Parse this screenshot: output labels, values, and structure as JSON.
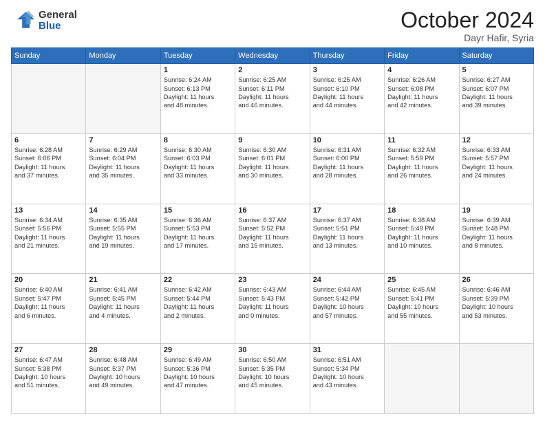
{
  "logo": {
    "general": "General",
    "blue": "Blue"
  },
  "header": {
    "month": "October 2024",
    "location": "Dayr Hafir, Syria"
  },
  "weekdays": [
    "Sunday",
    "Monday",
    "Tuesday",
    "Wednesday",
    "Thursday",
    "Friday",
    "Saturday"
  ],
  "weeks": [
    [
      {
        "day": "",
        "info": ""
      },
      {
        "day": "",
        "info": ""
      },
      {
        "day": "1",
        "info": "Sunrise: 6:24 AM\nSunset: 6:13 PM\nDaylight: 11 hours\nand 48 minutes."
      },
      {
        "day": "2",
        "info": "Sunrise: 6:25 AM\nSunset: 6:11 PM\nDaylight: 11 hours\nand 46 minutes."
      },
      {
        "day": "3",
        "info": "Sunrise: 6:25 AM\nSunset: 6:10 PM\nDaylight: 11 hours\nand 44 minutes."
      },
      {
        "day": "4",
        "info": "Sunrise: 6:26 AM\nSunset: 6:08 PM\nDaylight: 11 hours\nand 42 minutes."
      },
      {
        "day": "5",
        "info": "Sunrise: 6:27 AM\nSunset: 6:07 PM\nDaylight: 11 hours\nand 39 minutes."
      }
    ],
    [
      {
        "day": "6",
        "info": "Sunrise: 6:28 AM\nSunset: 6:06 PM\nDaylight: 11 hours\nand 37 minutes."
      },
      {
        "day": "7",
        "info": "Sunrise: 6:29 AM\nSunset: 6:04 PM\nDaylight: 11 hours\nand 35 minutes."
      },
      {
        "day": "8",
        "info": "Sunrise: 6:30 AM\nSunset: 6:03 PM\nDaylight: 11 hours\nand 33 minutes."
      },
      {
        "day": "9",
        "info": "Sunrise: 6:30 AM\nSunset: 6:01 PM\nDaylight: 11 hours\nand 30 minutes."
      },
      {
        "day": "10",
        "info": "Sunrise: 6:31 AM\nSunset: 6:00 PM\nDaylight: 11 hours\nand 28 minutes."
      },
      {
        "day": "11",
        "info": "Sunrise: 6:32 AM\nSunset: 5:59 PM\nDaylight: 11 hours\nand 26 minutes."
      },
      {
        "day": "12",
        "info": "Sunrise: 6:33 AM\nSunset: 5:57 PM\nDaylight: 11 hours\nand 24 minutes."
      }
    ],
    [
      {
        "day": "13",
        "info": "Sunrise: 6:34 AM\nSunset: 5:56 PM\nDaylight: 11 hours\nand 21 minutes."
      },
      {
        "day": "14",
        "info": "Sunrise: 6:35 AM\nSunset: 5:55 PM\nDaylight: 11 hours\nand 19 minutes."
      },
      {
        "day": "15",
        "info": "Sunrise: 6:36 AM\nSunset: 5:53 PM\nDaylight: 11 hours\nand 17 minutes."
      },
      {
        "day": "16",
        "info": "Sunrise: 6:37 AM\nSunset: 5:52 PM\nDaylight: 11 hours\nand 15 minutes."
      },
      {
        "day": "17",
        "info": "Sunrise: 6:37 AM\nSunset: 5:51 PM\nDaylight: 11 hours\nand 13 minutes."
      },
      {
        "day": "18",
        "info": "Sunrise: 6:38 AM\nSunset: 5:49 PM\nDaylight: 11 hours\nand 10 minutes."
      },
      {
        "day": "19",
        "info": "Sunrise: 6:39 AM\nSunset: 5:48 PM\nDaylight: 11 hours\nand 8 minutes."
      }
    ],
    [
      {
        "day": "20",
        "info": "Sunrise: 6:40 AM\nSunset: 5:47 PM\nDaylight: 11 hours\nand 6 minutes."
      },
      {
        "day": "21",
        "info": "Sunrise: 6:41 AM\nSunset: 5:45 PM\nDaylight: 11 hours\nand 4 minutes."
      },
      {
        "day": "22",
        "info": "Sunrise: 6:42 AM\nSunset: 5:44 PM\nDaylight: 11 hours\nand 2 minutes."
      },
      {
        "day": "23",
        "info": "Sunrise: 6:43 AM\nSunset: 5:43 PM\nDaylight: 11 hours\nand 0 minutes."
      },
      {
        "day": "24",
        "info": "Sunrise: 6:44 AM\nSunset: 5:42 PM\nDaylight: 10 hours\nand 57 minutes."
      },
      {
        "day": "25",
        "info": "Sunrise: 6:45 AM\nSunset: 5:41 PM\nDaylight: 10 hours\nand 55 minutes."
      },
      {
        "day": "26",
        "info": "Sunrise: 6:46 AM\nSunset: 5:39 PM\nDaylight: 10 hours\nand 53 minutes."
      }
    ],
    [
      {
        "day": "27",
        "info": "Sunrise: 6:47 AM\nSunset: 5:38 PM\nDaylight: 10 hours\nand 51 minutes."
      },
      {
        "day": "28",
        "info": "Sunrise: 6:48 AM\nSunset: 5:37 PM\nDaylight: 10 hours\nand 49 minutes."
      },
      {
        "day": "29",
        "info": "Sunrise: 6:49 AM\nSunset: 5:36 PM\nDaylight: 10 hours\nand 47 minutes."
      },
      {
        "day": "30",
        "info": "Sunrise: 6:50 AM\nSunset: 5:35 PM\nDaylight: 10 hours\nand 45 minutes."
      },
      {
        "day": "31",
        "info": "Sunrise: 6:51 AM\nSunset: 5:34 PM\nDaylight: 10 hours\nand 43 minutes."
      },
      {
        "day": "",
        "info": ""
      },
      {
        "day": "",
        "info": ""
      }
    ]
  ]
}
